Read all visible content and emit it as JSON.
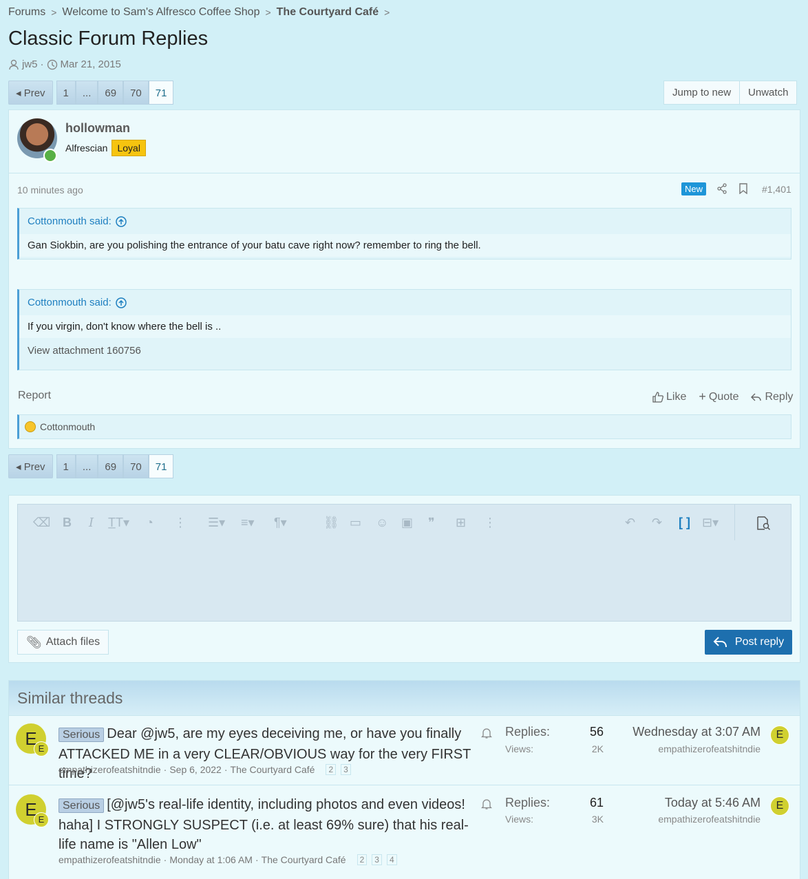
{
  "breadcrumb": {
    "items": [
      "Forums",
      "Welcome to Sam's Alfresco Coffee Shop"
    ],
    "current": "The Courtyard Café"
  },
  "thread": {
    "title": "Classic Forum Replies",
    "author": "jw5",
    "date": "Mar 21, 2015"
  },
  "pagination": {
    "prev": "Prev",
    "pages": [
      "1",
      "...",
      "69",
      "70",
      "71"
    ],
    "current": "71"
  },
  "thread_actions": {
    "jump": "Jump to new",
    "unwatch": "Unwatch"
  },
  "post": {
    "username": "hollowman",
    "user_title": "Alfrescian",
    "banner": "Loyal",
    "time": "10 minutes ago",
    "new_badge": "New",
    "number": "#1,401",
    "quotes": [
      {
        "author": "Cottonmouth said:",
        "text": "Gan Siokbin, are you polishing the entrance of your batu cave right now? remember to ring the bell."
      },
      {
        "author": "Cottonmouth said:",
        "text": "If you virgin, don't know where the bell is ..",
        "attachment": "View attachment 160756"
      }
    ],
    "report": "Report",
    "like": "Like",
    "quote": "Quote",
    "reply": "Reply",
    "reaction_user": "Cottonmouth"
  },
  "editor": {
    "attach": "Attach files",
    "post_reply": "Post reply"
  },
  "similar": {
    "heading": "Similar threads",
    "threads": [
      {
        "avatar": "E",
        "prefix": "Serious",
        "title": "Dear @jw5, are my eyes deceiving me, or have you finally ATTACKED ME in a very CLEAR/OBVIOUS way for the very FIRST time?",
        "starter": "empathizerofeatshitndie",
        "date": "Sep 6, 2022",
        "forum": "The Courtyard Café",
        "pages": [
          "2",
          "3"
        ],
        "replies_label": "Replies:",
        "replies": "56",
        "views_label": "Views:",
        "views": "2K",
        "last_date": "Wednesday at 3:07 AM",
        "last_user": "empathizerofeatshitndie"
      },
      {
        "avatar": "E",
        "prefix": "Serious",
        "title": "[@jw5's real-life identity, including photos and even videos! haha] I STRONGLY SUSPECT (i.e. at least 69% sure) that his real-life name is \"Allen Low\"",
        "starter": "empathizerofeatshitndie",
        "date": "Monday at 1:06 AM",
        "forum": "The Courtyard Café",
        "pages": [
          "2",
          "3",
          "4"
        ],
        "replies_label": "Replies:",
        "replies": "61",
        "views_label": "Views:",
        "views": "3K",
        "last_date": "Today at 5:46 AM",
        "last_user": "empathizerofeatshitndie"
      }
    ]
  }
}
